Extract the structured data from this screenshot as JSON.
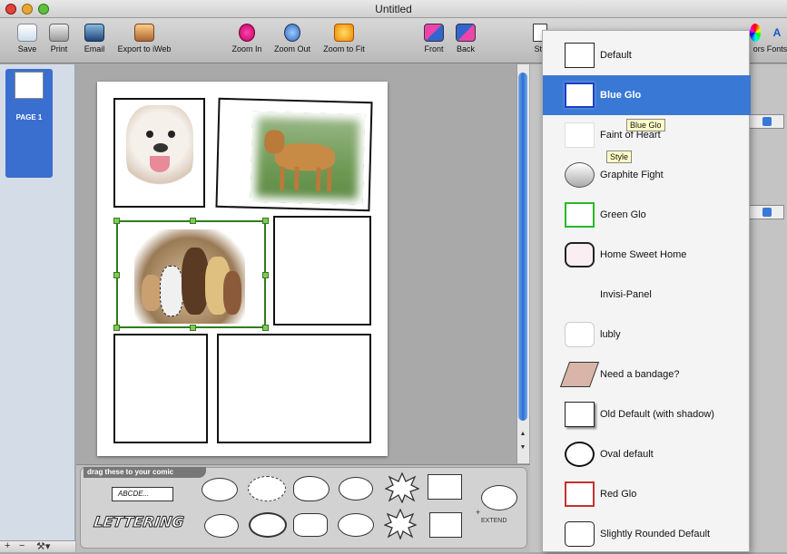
{
  "window": {
    "title": "Untitled"
  },
  "toolbar": {
    "save": "Save",
    "print": "Print",
    "email": "Email",
    "export": "Export to iWeb",
    "zoom_in": "Zoom In",
    "zoom_out": "Zoom Out",
    "zoom_fit": "Zoom to Fit",
    "front": "Front",
    "back": "Back",
    "style_partial": "Sty",
    "colors_partial": "ors",
    "fonts": "Fonts"
  },
  "sidebar": {
    "page_label": "PAGE 1"
  },
  "palette": {
    "header": "drag these to your comic",
    "caption_sample": "ABCDE...",
    "lettering": "LETTERING",
    "extend": "EXTEND"
  },
  "style_menu": {
    "items": [
      {
        "label": "Default"
      },
      {
        "label": "Blue Glo"
      },
      {
        "label": "Faint of Heart"
      },
      {
        "label": "Graphite Fight"
      },
      {
        "label": "Green Glo"
      },
      {
        "label": "Home Sweet Home"
      },
      {
        "label": "Invisi-Panel"
      },
      {
        "label": "lubly"
      },
      {
        "label": "Need a bandage?"
      },
      {
        "label": "Old Default (with shadow)"
      },
      {
        "label": "Oval default"
      },
      {
        "label": "Red Glo"
      },
      {
        "label": "Slightly Rounded Default"
      }
    ],
    "selected": "Blue Glo"
  },
  "tooltips": {
    "blue_glo": "Blue Glo",
    "style": "Style"
  },
  "colors": {
    "highlight": "#3a78d6",
    "selection_handles": "#7ec95a"
  }
}
